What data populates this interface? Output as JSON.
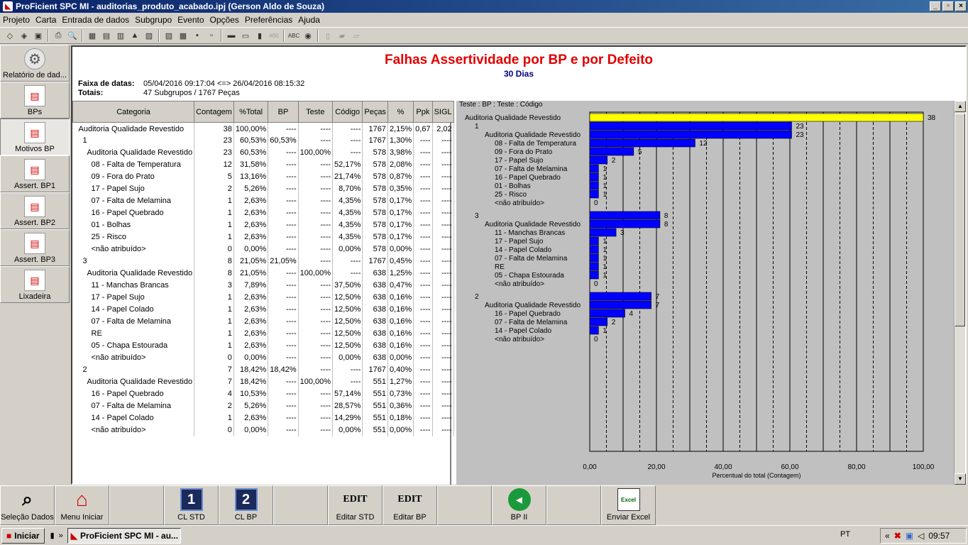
{
  "window": {
    "title": "ProFicient SPC MI - auditorias_produto_acabado.ipj (Gerson Aldo de Souza)",
    "buttons": [
      "_",
      "▫",
      "×"
    ]
  },
  "menu": [
    "Projeto",
    "Carta",
    "Entrada de dados",
    "Subgrupo",
    "Evento",
    "Opções",
    "Preferências",
    "Ajuda"
  ],
  "toolbar_icons": [
    "◇",
    "◈",
    "▣",
    "⎙",
    "🔍",
    "▦",
    "▤",
    "▥",
    "▲",
    "▧",
    "▨",
    "▩",
    "▪",
    "▫",
    "▬",
    "▭",
    "▮",
    "#00",
    "ABC",
    "◉",
    "▯",
    "▰",
    "▱"
  ],
  "sidebar": [
    {
      "label": "Relatório de dad...",
      "icon": "gear-icon"
    },
    {
      "label": "BPs",
      "icon": "chart-icon"
    },
    {
      "label": "Motivos BP",
      "icon": "chart-icon",
      "active": true
    },
    {
      "label": "Assert. BP1",
      "icon": "chart-icon"
    },
    {
      "label": "Assert. BP2",
      "icon": "chart-icon"
    },
    {
      "label": "Assert. BP3",
      "icon": "chart-icon"
    },
    {
      "label": "Lixadeira",
      "icon": "chart-icon"
    }
  ],
  "report": {
    "title": "Falhas Assertividade por BP e por Defeito",
    "subtitle": "30 Dias",
    "range_label": "Faixa de datas:",
    "range_value": "05/04/2016  09:17:04 <=> 26/04/2016  08:15:32",
    "totals_label": "Totais:",
    "totals_value": "47 Subgrupos  / 1767 Peças"
  },
  "table": {
    "headers": [
      "Categoria",
      "Contagem",
      "%Total",
      "BP",
      "Teste",
      "Código",
      "Peças",
      "%",
      "Ppk",
      "SIGL"
    ],
    "rows": [
      {
        "indent": 0,
        "c": [
          "Auditoria Qualidade Revestido",
          "38",
          "100,00%",
          "----",
          "----",
          "----",
          "1767",
          "2,15%",
          "0,67",
          "2,02"
        ]
      },
      {
        "indent": 1,
        "c": [
          "1",
          "23",
          "60,53%",
          "60,53%",
          "----",
          "----",
          "1767",
          "1,30%",
          "----",
          "----"
        ]
      },
      {
        "indent": 2,
        "c": [
          "Auditoria Qualidade Revestido",
          "23",
          "60,53%",
          "----",
          "100,00%",
          "----",
          "578",
          "3,98%",
          "----",
          "----"
        ]
      },
      {
        "indent": 3,
        "c": [
          "08 - Falta de Temperatura",
          "12",
          "31,58%",
          "----",
          "----",
          "52,17%",
          "578",
          "2,08%",
          "----",
          "----"
        ]
      },
      {
        "indent": 3,
        "c": [
          "09 - Fora do Prato",
          "5",
          "13,16%",
          "----",
          "----",
          "21,74%",
          "578",
          "0,87%",
          "----",
          "----"
        ]
      },
      {
        "indent": 3,
        "c": [
          "17 - Papel Sujo",
          "2",
          "5,26%",
          "----",
          "----",
          "8,70%",
          "578",
          "0,35%",
          "----",
          "----"
        ]
      },
      {
        "indent": 3,
        "c": [
          "07 - Falta de Melamina",
          "1",
          "2,63%",
          "----",
          "----",
          "4,35%",
          "578",
          "0,17%",
          "----",
          "----"
        ]
      },
      {
        "indent": 3,
        "c": [
          "16 - Papel Quebrado",
          "1",
          "2,63%",
          "----",
          "----",
          "4,35%",
          "578",
          "0,17%",
          "----",
          "----"
        ]
      },
      {
        "indent": 3,
        "c": [
          "01 - Bolhas",
          "1",
          "2,63%",
          "----",
          "----",
          "4,35%",
          "578",
          "0,17%",
          "----",
          "----"
        ]
      },
      {
        "indent": 3,
        "c": [
          "25 - Risco",
          "1",
          "2,63%",
          "----",
          "----",
          "4,35%",
          "578",
          "0,17%",
          "----",
          "----"
        ]
      },
      {
        "indent": 3,
        "c": [
          "<não atribuído>",
          "0",
          "0,00%",
          "----",
          "----",
          "0,00%",
          "578",
          "0,00%",
          "----",
          "----"
        ]
      },
      {
        "indent": 1,
        "c": [
          "3",
          "8",
          "21,05%",
          "21,05%",
          "----",
          "----",
          "1767",
          "0,45%",
          "----",
          "----"
        ]
      },
      {
        "indent": 2,
        "c": [
          "Auditoria Qualidade Revestido",
          "8",
          "21,05%",
          "----",
          "100,00%",
          "----",
          "638",
          "1,25%",
          "----",
          "----"
        ]
      },
      {
        "indent": 3,
        "c": [
          "11 - Manchas Brancas",
          "3",
          "7,89%",
          "----",
          "----",
          "37,50%",
          "638",
          "0,47%",
          "----",
          "----"
        ]
      },
      {
        "indent": 3,
        "c": [
          "17 - Papel Sujo",
          "1",
          "2,63%",
          "----",
          "----",
          "12,50%",
          "638",
          "0,16%",
          "----",
          "----"
        ]
      },
      {
        "indent": 3,
        "c": [
          "14 - Papel Colado",
          "1",
          "2,63%",
          "----",
          "----",
          "12,50%",
          "638",
          "0,16%",
          "----",
          "----"
        ]
      },
      {
        "indent": 3,
        "c": [
          "07 - Falta de Melamina",
          "1",
          "2,63%",
          "----",
          "----",
          "12,50%",
          "638",
          "0,16%",
          "----",
          "----"
        ]
      },
      {
        "indent": 3,
        "c": [
          "RE",
          "1",
          "2,63%",
          "----",
          "----",
          "12,50%",
          "638",
          "0,16%",
          "----",
          "----"
        ]
      },
      {
        "indent": 3,
        "c": [
          "05 - Chapa Estourada",
          "1",
          "2,63%",
          "----",
          "----",
          "12,50%",
          "638",
          "0,16%",
          "----",
          "----"
        ]
      },
      {
        "indent": 3,
        "c": [
          "<não atribuído>",
          "0",
          "0,00%",
          "----",
          "----",
          "0,00%",
          "638",
          "0,00%",
          "----",
          "----"
        ]
      },
      {
        "indent": 1,
        "c": [
          "2",
          "7",
          "18,42%",
          "18,42%",
          "----",
          "----",
          "1767",
          "0,40%",
          "----",
          "----"
        ]
      },
      {
        "indent": 2,
        "c": [
          "Auditoria Qualidade Revestido",
          "7",
          "18,42%",
          "----",
          "100,00%",
          "----",
          "551",
          "1,27%",
          "----",
          "----"
        ]
      },
      {
        "indent": 3,
        "c": [
          "16 - Papel Quebrado",
          "4",
          "10,53%",
          "----",
          "----",
          "57,14%",
          "551",
          "0,73%",
          "----",
          "----"
        ]
      },
      {
        "indent": 3,
        "c": [
          "07 - Falta de Melamina",
          "2",
          "5,26%",
          "----",
          "----",
          "28,57%",
          "551",
          "0,36%",
          "----",
          "----"
        ]
      },
      {
        "indent": 3,
        "c": [
          "14 - Papel Colado",
          "1",
          "2,63%",
          "----",
          "----",
          "14,29%",
          "551",
          "0,18%",
          "----",
          "----"
        ]
      },
      {
        "indent": 3,
        "c": [
          "<não atribuído>",
          "0",
          "0,00%",
          "----",
          "----",
          "0,00%",
          "551",
          "0,00%",
          "----",
          "----"
        ]
      }
    ]
  },
  "chart_data": {
    "type": "bar",
    "header": "Teste : BP : Teste : Código",
    "xlabel": "Percentual do total (Contagem)",
    "xlim": [
      0,
      100
    ],
    "xticks": [
      "0,00",
      "20,00",
      "40,00",
      "60,00",
      "80,00",
      "100,00"
    ],
    "bars": [
      {
        "label": "Auditoria Qualidade Revestido",
        "indent": 0,
        "value": 38,
        "pct": 100,
        "color": "#ffff00"
      },
      {
        "label": "1",
        "indent": 1,
        "value": 23,
        "pct": 60.53,
        "color": "#0000ff"
      },
      {
        "label": "Auditoria Qualidade Revestido",
        "indent": 2,
        "value": 23,
        "pct": 60.53,
        "color": "#0000ff"
      },
      {
        "label": "08 - Falta de Temperatura",
        "indent": 3,
        "value": 12,
        "pct": 31.58,
        "color": "#0000ff"
      },
      {
        "label": "09 - Fora do Prato",
        "indent": 3,
        "value": 5,
        "pct": 13.16,
        "color": "#0000ff"
      },
      {
        "label": "17 - Papel Sujo",
        "indent": 3,
        "value": 2,
        "pct": 5.26,
        "color": "#0000ff"
      },
      {
        "label": "07 - Falta de Melamina",
        "indent": 3,
        "value": 1,
        "pct": 2.63,
        "color": "#0000ff"
      },
      {
        "label": "16 - Papel Quebrado",
        "indent": 3,
        "value": 1,
        "pct": 2.63,
        "color": "#0000ff"
      },
      {
        "label": "01 - Bolhas",
        "indent": 3,
        "value": 1,
        "pct": 2.63,
        "color": "#0000ff"
      },
      {
        "label": "25 - Risco",
        "indent": 3,
        "value": 1,
        "pct": 2.63,
        "color": "#0000ff"
      },
      {
        "label": "<não atribuído>",
        "indent": 3,
        "value": 0,
        "pct": 0,
        "color": "#0000ff"
      },
      {
        "label": "3",
        "indent": 1,
        "value": 8,
        "pct": 21.05,
        "color": "#0000ff",
        "gap": true
      },
      {
        "label": "Auditoria Qualidade Revestido",
        "indent": 2,
        "value": 8,
        "pct": 21.05,
        "color": "#0000ff"
      },
      {
        "label": "11 - Manchas Brancas",
        "indent": 3,
        "value": 3,
        "pct": 7.89,
        "color": "#0000ff"
      },
      {
        "label": "17 - Papel Sujo",
        "indent": 3,
        "value": 1,
        "pct": 2.63,
        "color": "#0000ff"
      },
      {
        "label": "14 - Papel Colado",
        "indent": 3,
        "value": 1,
        "pct": 2.63,
        "color": "#0000ff"
      },
      {
        "label": "07 - Falta de Melamina",
        "indent": 3,
        "value": 1,
        "pct": 2.63,
        "color": "#0000ff"
      },
      {
        "label": "RE",
        "indent": 3,
        "value": 1,
        "pct": 2.63,
        "color": "#0000ff"
      },
      {
        "label": "05 - Chapa Estourada",
        "indent": 3,
        "value": 1,
        "pct": 2.63,
        "color": "#0000ff"
      },
      {
        "label": "<não atribuído>",
        "indent": 3,
        "value": 0,
        "pct": 0,
        "color": "#0000ff"
      },
      {
        "label": "2",
        "indent": 1,
        "value": 7,
        "pct": 18.42,
        "color": "#0000ff",
        "gap": true
      },
      {
        "label": "Auditoria Qualidade Revestido",
        "indent": 2,
        "value": 7,
        "pct": 18.42,
        "color": "#0000ff"
      },
      {
        "label": "16 - Papel Quebrado",
        "indent": 3,
        "value": 4,
        "pct": 10.53,
        "color": "#0000ff"
      },
      {
        "label": "07 - Falta de Melamina",
        "indent": 3,
        "value": 2,
        "pct": 5.26,
        "color": "#0000ff"
      },
      {
        "label": "14 - Papel Colado",
        "indent": 3,
        "value": 1,
        "pct": 2.63,
        "color": "#0000ff"
      },
      {
        "label": "<não atribuído>",
        "indent": 3,
        "value": 0,
        "pct": 0,
        "color": "#0000ff"
      }
    ]
  },
  "bottom": [
    {
      "label": "Seleção Dados",
      "icon": "binoculars-icon",
      "glyph": "⌕"
    },
    {
      "label": "Menu Iniciar",
      "icon": "home-icon",
      "glyph": "⌂"
    },
    {
      "label": "",
      "icon": "",
      "glyph": ""
    },
    {
      "label": "CL STD",
      "icon": "one-icon",
      "glyph": "1"
    },
    {
      "label": "CL BP",
      "icon": "two-icon",
      "glyph": "2"
    },
    {
      "label": "",
      "icon": "",
      "glyph": ""
    },
    {
      "label": "Editar STD",
      "icon": "edit-icon",
      "glyph": "EDIT"
    },
    {
      "label": "Editar BP",
      "icon": "edit-icon",
      "glyph": "EDIT"
    },
    {
      "label": "",
      "icon": "",
      "glyph": ""
    },
    {
      "label": "BP II",
      "icon": "arrow-circle-icon",
      "glyph": "◀"
    },
    {
      "label": "",
      "icon": "",
      "glyph": ""
    },
    {
      "label": "Enviar Excel",
      "icon": "excel-icon",
      "glyph": "Excel"
    }
  ],
  "taskbar": {
    "start": "Iniciar",
    "task": "ProFicient SPC MI - au...",
    "lang": "PT",
    "time": "09:57",
    "quick": [
      "▮",
      "»"
    ]
  }
}
